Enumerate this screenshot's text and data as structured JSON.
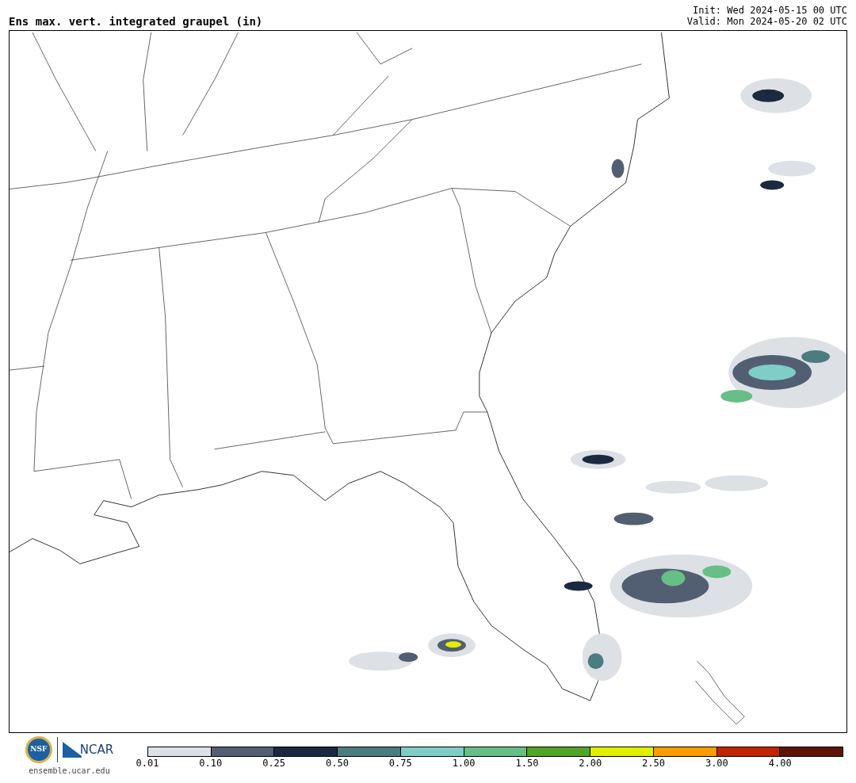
{
  "title": "Ens max. vert. integrated graupel (in)",
  "init": "Init: Wed 2024-05-15 00 UTC",
  "valid": "Valid: Mon 2024-05-20 02 UTC",
  "logos": {
    "nsf": "NSF",
    "ncar": "NCAR",
    "url": "ensemble.ucar.edu"
  },
  "colorbar": {
    "bins": [
      {
        "color": "#dde1e5"
      },
      {
        "color": "#525f73"
      },
      {
        "color": "#1b2a41"
      },
      {
        "color": "#4a7c80"
      },
      {
        "color": "#80cdc8"
      },
      {
        "color": "#67be86"
      },
      {
        "color": "#52a428"
      },
      {
        "color": "#e2f000"
      },
      {
        "color": "#ff9d00"
      },
      {
        "color": "#c32400"
      },
      {
        "color": "#5f1408"
      }
    ],
    "ticks": [
      "0.01",
      "0.10",
      "0.25",
      "0.50",
      "0.75",
      "1.00",
      "1.50",
      "2.00",
      "2.50",
      "3.00",
      "4.00"
    ]
  }
}
